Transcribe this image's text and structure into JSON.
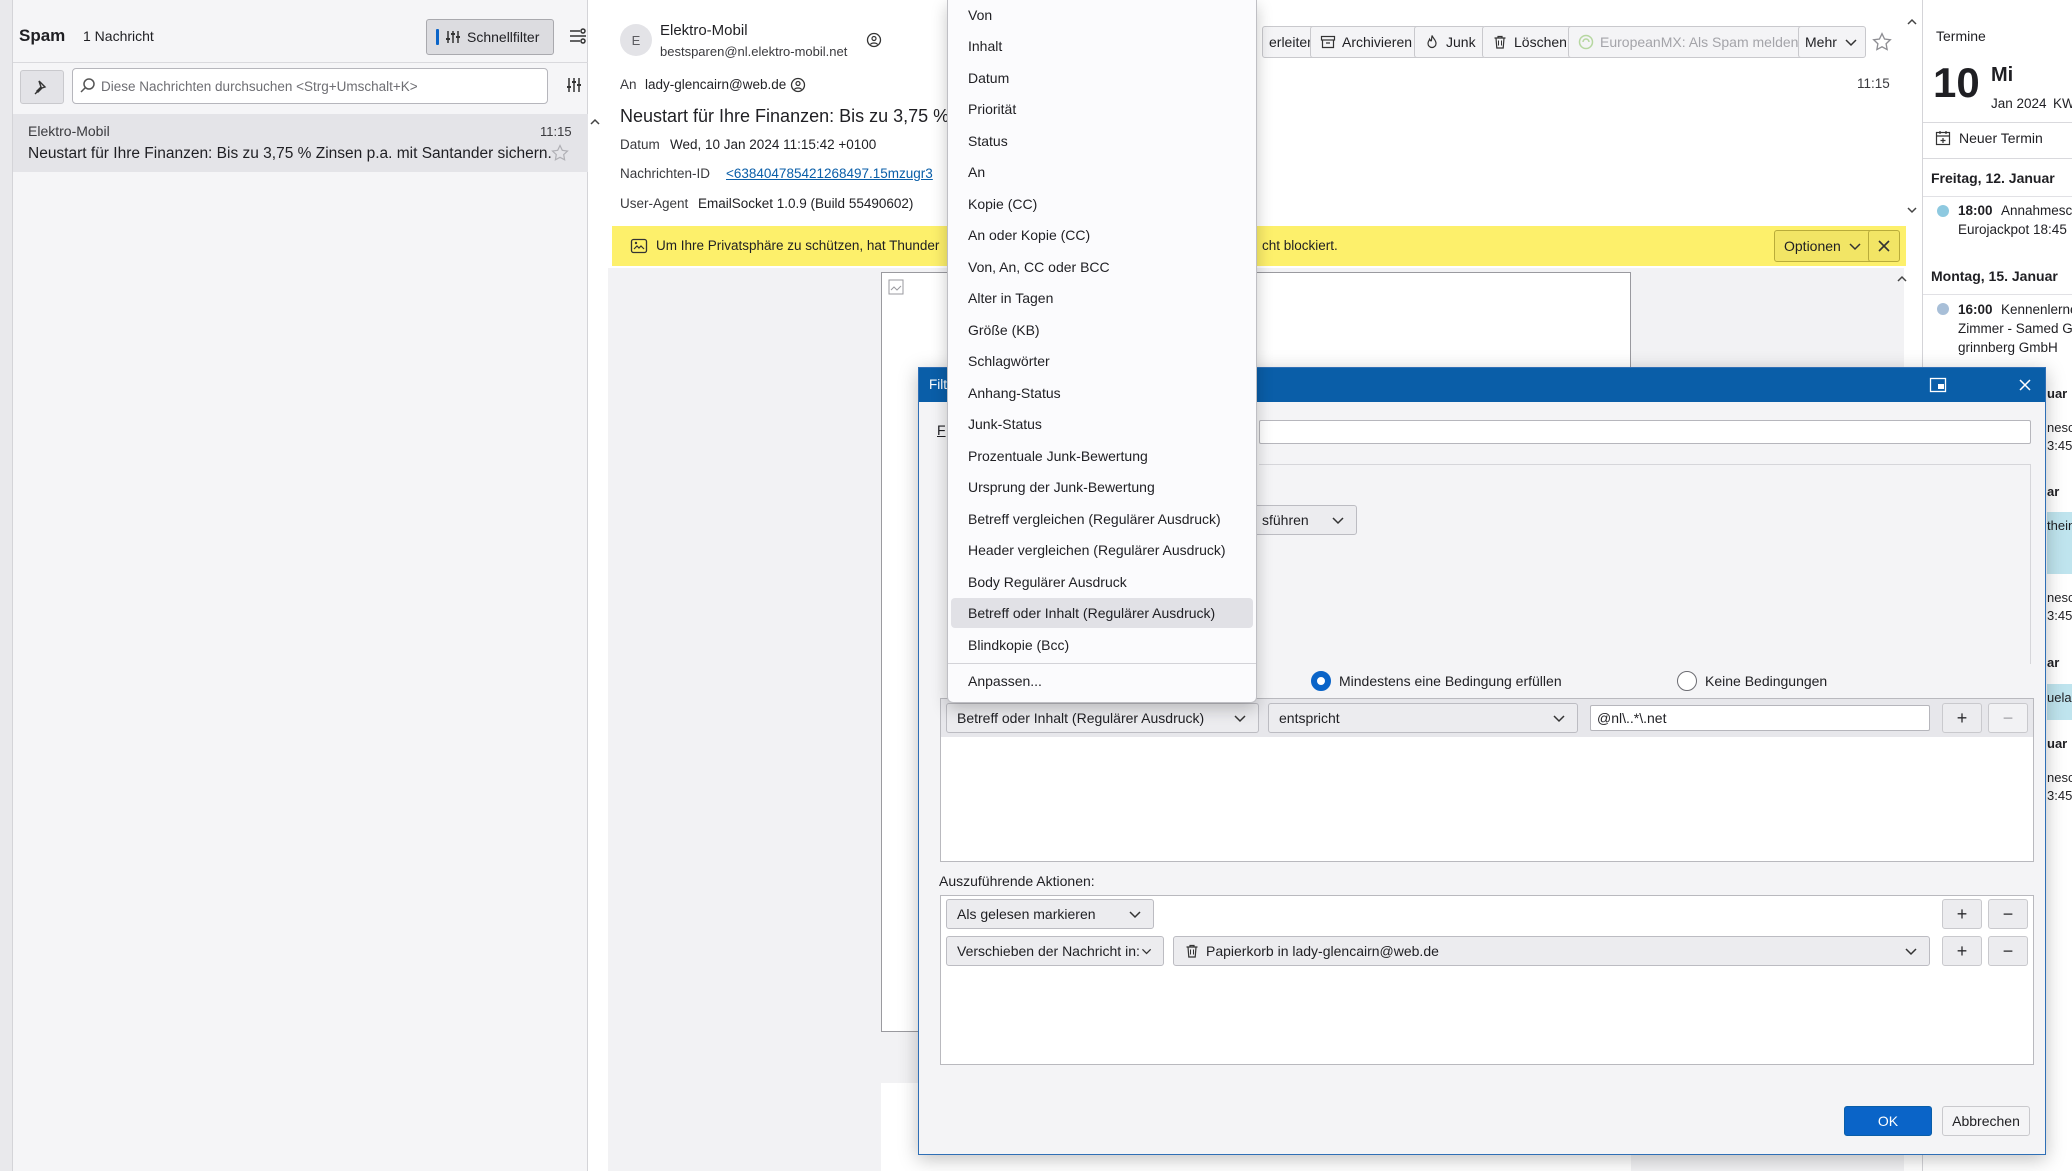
{
  "folder_header": {
    "name": "Spam",
    "count": "1 Nachricht",
    "quick_filter": "Schnellfilter"
  },
  "search": {
    "placeholder": "Diese Nachrichten durchsuchen <Strg+Umschalt+K>"
  },
  "message_list": [
    {
      "sender": "Elektro-Mobil",
      "time": "11:15",
      "subject": "Neustart für Ihre Finanzen: Bis zu 3,75 % Zinsen p.a. mit Santander sichern."
    }
  ],
  "message": {
    "avatar_letter": "E",
    "from_name": "Elektro-Mobil",
    "from_email": "bestsparen@nl.elektro-mobil.net",
    "to_label": "An",
    "to": "lady-glencairn@web.de",
    "subject": "Neustart für Ihre Finanzen: Bis zu 3,75 %",
    "time": "11:15",
    "date_label": "Datum",
    "date": "Wed, 10 Jan 2024 11:15:42 +0100",
    "msgid_label": "Nachrichten-ID",
    "msgid": "<638404785421268497.15mzugr3",
    "useragent_label": "User-Agent",
    "useragent": "EmailSocket 1.0.9 (Build 55490602)"
  },
  "toolbar": {
    "forward": "erleiten",
    "archive": "Archivieren",
    "junk": "Junk",
    "delete": "Löschen",
    "report": "EuropeanMX: Als Spam melden",
    "more": "Mehr"
  },
  "privacy_bar": {
    "text_left": "Um Ihre Privatsphäre zu schützen, hat Thunder",
    "text_right": "cht blockiert.",
    "options": "Optionen"
  },
  "today_pane": {
    "title": "Termine",
    "day_number": "10",
    "weekday": "Mi",
    "month_year": "Jan 2024",
    "kw": "KW",
    "new_event": "Neuer Termin",
    "groups": [
      {
        "heading": "Freitag, 12. Januar",
        "events": [
          {
            "time": "18:00",
            "line1": "Annahmesc",
            "line2": "Eurojackpot 18:45",
            "color": "#8ec9e0"
          }
        ]
      },
      {
        "heading": "Montag, 15. Januar",
        "events": [
          {
            "time": "16:00",
            "line1": "Kennenlerne",
            "line2": "Zimmer - Samed G",
            "line3": "grinnberg GmbH",
            "color": "#a8bfd8"
          }
        ]
      }
    ],
    "fragments": [
      "uar",
      "nesc",
      "3:45",
      "ar",
      "thein",
      "nesc",
      "3:45",
      "ar",
      "uela",
      "uar",
      "nesc",
      "3:45"
    ]
  },
  "attribute_menu": {
    "items": [
      "Von",
      "Inhalt",
      "Datum",
      "Priorität",
      "Status",
      "An",
      "Kopie (CC)",
      "An oder Kopie (CC)",
      "Von, An, CC oder BCC",
      "Alter in Tagen",
      "Größe (KB)",
      "Schlagwörter",
      "Anhang-Status",
      "Junk-Status",
      "Prozentuale Junk-Bewertung",
      "Ursprung der Junk-Bewertung",
      "Betreff vergleichen (Regulärer Ausdruck)",
      "Header vergleichen (Regulärer Ausdruck)",
      "Body Regulärer Ausdruck",
      "Betreff oder Inhalt (Regulärer Ausdruck)",
      "Blindkopie (Bcc)"
    ],
    "selected_index": 19,
    "customize": "Anpassen..."
  },
  "filter_dialog": {
    "title": "Filt",
    "name_label_fragment": "F",
    "run_dropdown_fragment": "sführen",
    "match_any": "Mindestens eine Bedingung erfüllen",
    "match_none": "Keine Bedingungen",
    "condition": {
      "attribute": "Betreff oder Inhalt (Regulärer Ausdruck)",
      "operator": "entspricht",
      "value": "@nl\\..*\\.net"
    },
    "actions_label": "Auszuführende Aktionen:",
    "actions": [
      {
        "type": "Als gelesen markieren"
      },
      {
        "type": "Verschieben der Nachricht in:",
        "target": "Papierkorb in lady-glencairn@web.de"
      }
    ],
    "ok": "OK",
    "cancel": "Abbrechen"
  }
}
